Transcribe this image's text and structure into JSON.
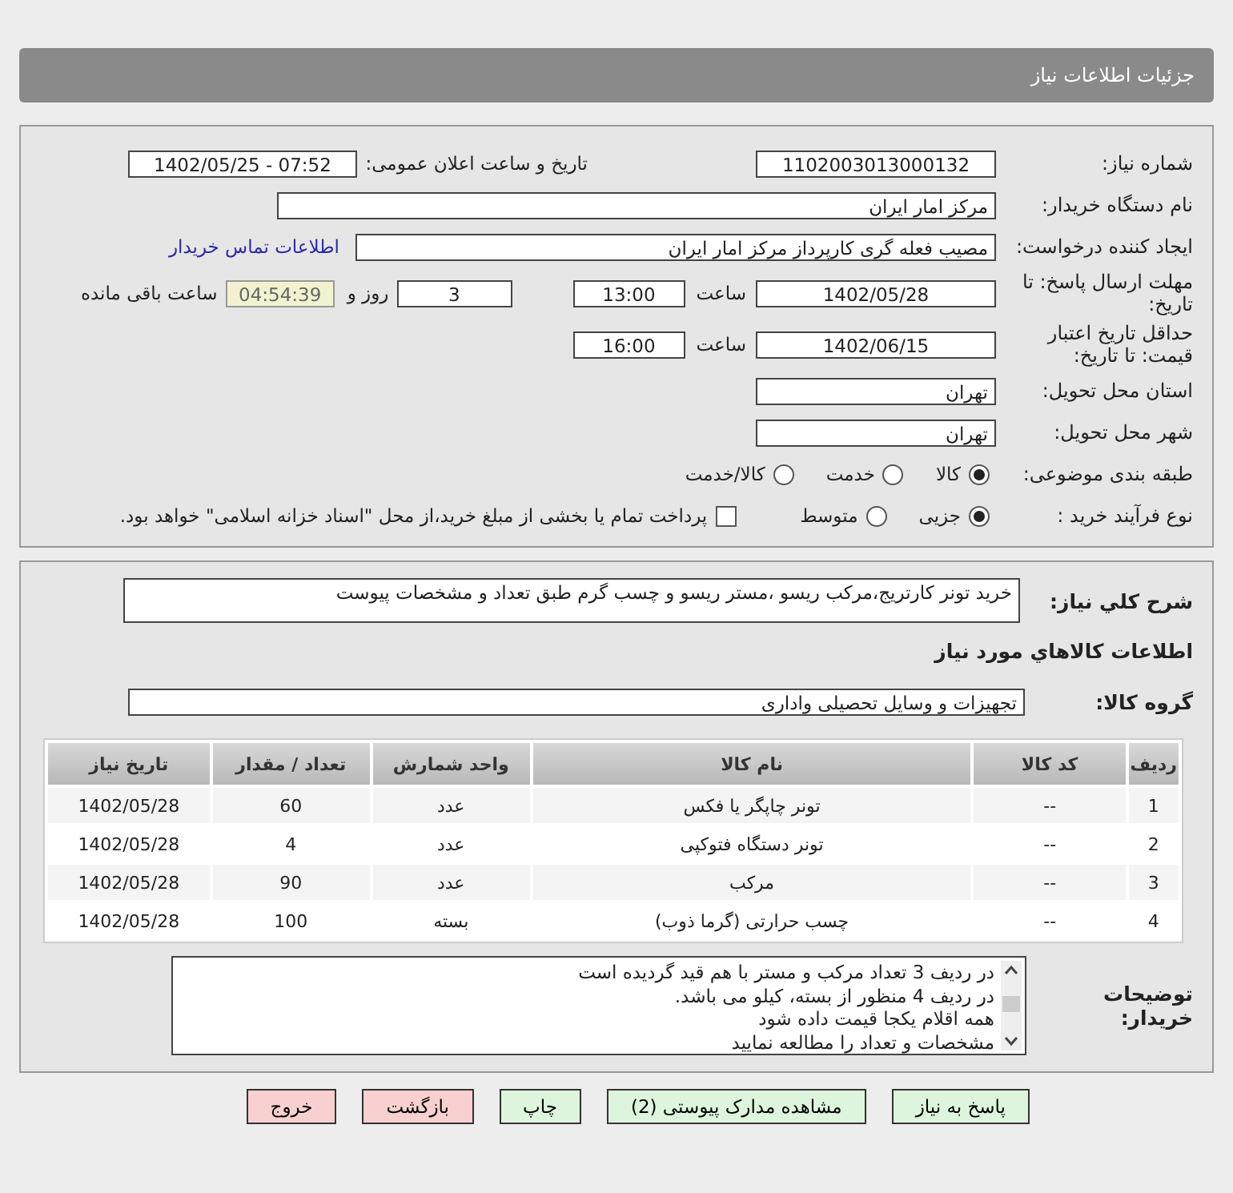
{
  "title": "جزئیات اطلاعات نیاز",
  "need": {
    "number_label": "شماره نیاز:",
    "number": "1102003013000132",
    "announce_label": "تاریخ و ساعت اعلان عمومی:",
    "announce": "1402/05/25 - 07:52",
    "buyer_label": "نام دستگاه خریدار:",
    "buyer": "مرکز امار ایران",
    "creator_label": "ایجاد کننده درخواست:",
    "creator": "مصیب فعله گری کارپرداز مرکز امار ایران",
    "contact_link": "اطلاعات تماس خریدار",
    "deadline_label": "مهلت ارسال پاسخ: تا تاریخ:",
    "deadline_date": "1402/05/28",
    "deadline_time_label": "ساعت",
    "deadline_time": "13:00",
    "days": "3",
    "days_label": "روز و",
    "remaining": "04:54:39",
    "remaining_label": "ساعت باقی مانده",
    "validity_label": "حداقل تاریخ اعتبار قیمت: تا تاریخ:",
    "validity_date": "1402/06/15",
    "validity_time_label": "ساعت",
    "validity_time": "16:00",
    "province_label": "استان محل تحویل:",
    "province": "تهران",
    "city_label": "شهر محل تحویل:",
    "city": "تهران",
    "category_label": "طبقه بندی موضوعی:",
    "category_options": [
      {
        "label": "کالا",
        "selected": true
      },
      {
        "label": "خدمت",
        "selected": false
      },
      {
        "label": "کالا/خدمت",
        "selected": false
      }
    ],
    "process_label": "نوع فرآیند خرید :",
    "process_options": [
      {
        "label": "جزیی",
        "selected": true
      },
      {
        "label": "متوسط",
        "selected": false
      }
    ],
    "payment": {
      "checked": false,
      "label": "پرداخت تمام یا بخشی از مبلغ خرید،از محل \"اسناد خزانه اسلامی\" خواهد بود."
    }
  },
  "goods": {
    "description_label": "شرح کلي نياز:",
    "description": "خرید تونر کارتریج،مرکب ریسو ،مستر ریسو و چسب گرم طبق تعداد و مشخصات پیوست",
    "heading": "اطلاعات کالاهاي مورد نياز",
    "group_label": "گروه کالا:",
    "group": "تجهیزات و وسایل تحصیلی واداری",
    "table": {
      "columns": [
        "ردیف",
        "کد کالا",
        "نام کالا",
        "واحد شمارش",
        "تعداد / مقدار",
        "تاریخ نیاز"
      ],
      "rows": [
        [
          "1",
          "--",
          "تونر چاپگر یا فکس",
          "عدد",
          "60",
          "1402/05/28"
        ],
        [
          "2",
          "--",
          "تونر دستگاه فتوکپی",
          "عدد",
          "4",
          "1402/05/28"
        ],
        [
          "3",
          "--",
          "مرکب",
          "عدد",
          "90",
          "1402/05/28"
        ],
        [
          "4",
          "--",
          "چسب حرارتی (گرما ذوب)",
          "بسته",
          "100",
          "1402/05/28"
        ]
      ]
    },
    "notes_label": "توضیحات خریدار:",
    "notes": [
      "در ردیف 3 تعداد مرکب و مستر با هم قید گردیده است",
      "در ردیف 4 منظور از بسته، کیلو می باشد.",
      "همه اقلام یکجا قیمت داده شود",
      "مشخصات و تعداد را مطالعه نمایید"
    ]
  },
  "buttons": [
    {
      "label": "پاسخ به نیاز",
      "kind": "primary"
    },
    {
      "label": "مشاهده مدارک پیوستی (2)",
      "kind": "primary"
    },
    {
      "label": "چاپ",
      "kind": "primary"
    },
    {
      "label": "بازگشت",
      "kind": "danger"
    },
    {
      "label": "خروج",
      "kind": "danger"
    }
  ]
}
